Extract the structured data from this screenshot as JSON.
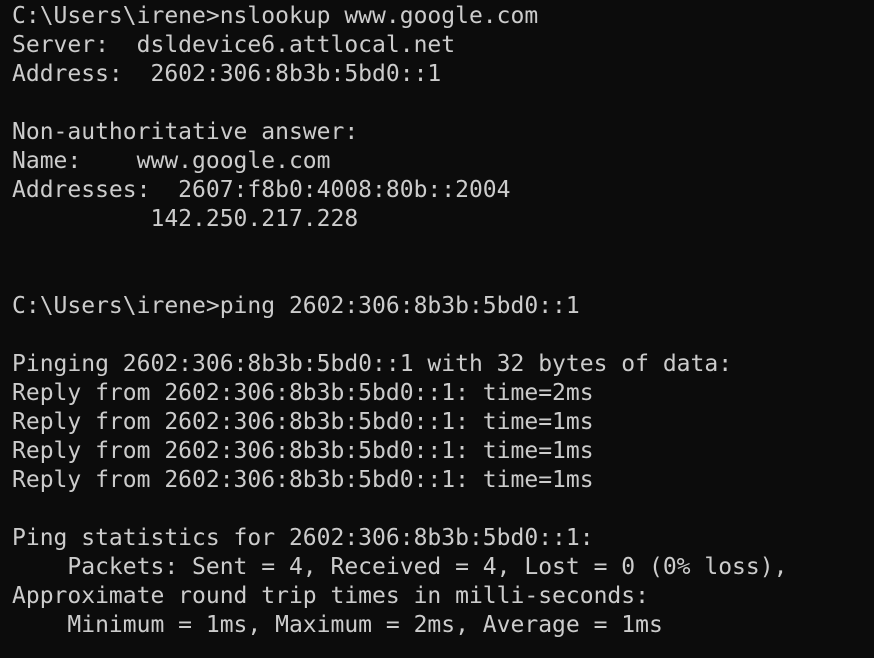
{
  "terminal": {
    "lines": [
      "C:\\Users\\irene>nslookup www.google.com",
      "Server:  dsldevice6.attlocal.net",
      "Address:  2602:306:8b3b:5bd0::1",
      "",
      "Non-authoritative answer:",
      "Name:    www.google.com",
      "Addresses:  2607:f8b0:4008:80b::2004",
      "          142.250.217.228",
      "",
      "",
      "C:\\Users\\irene>ping 2602:306:8b3b:5bd0::1",
      "",
      "Pinging 2602:306:8b3b:5bd0::1 with 32 bytes of data:",
      "Reply from 2602:306:8b3b:5bd0::1: time=2ms",
      "Reply from 2602:306:8b3b:5bd0::1: time=1ms",
      "Reply from 2602:306:8b3b:5bd0::1: time=1ms",
      "Reply from 2602:306:8b3b:5bd0::1: time=1ms",
      "",
      "Ping statistics for 2602:306:8b3b:5bd0::1:",
      "    Packets: Sent = 4, Received = 4, Lost = 0 (0% loss),",
      "Approximate round trip times in milli-seconds:",
      "    Minimum = 1ms, Maximum = 2ms, Average = 1ms"
    ]
  },
  "colors": {
    "background": "#0c0c0c",
    "text": "#cccccc"
  }
}
